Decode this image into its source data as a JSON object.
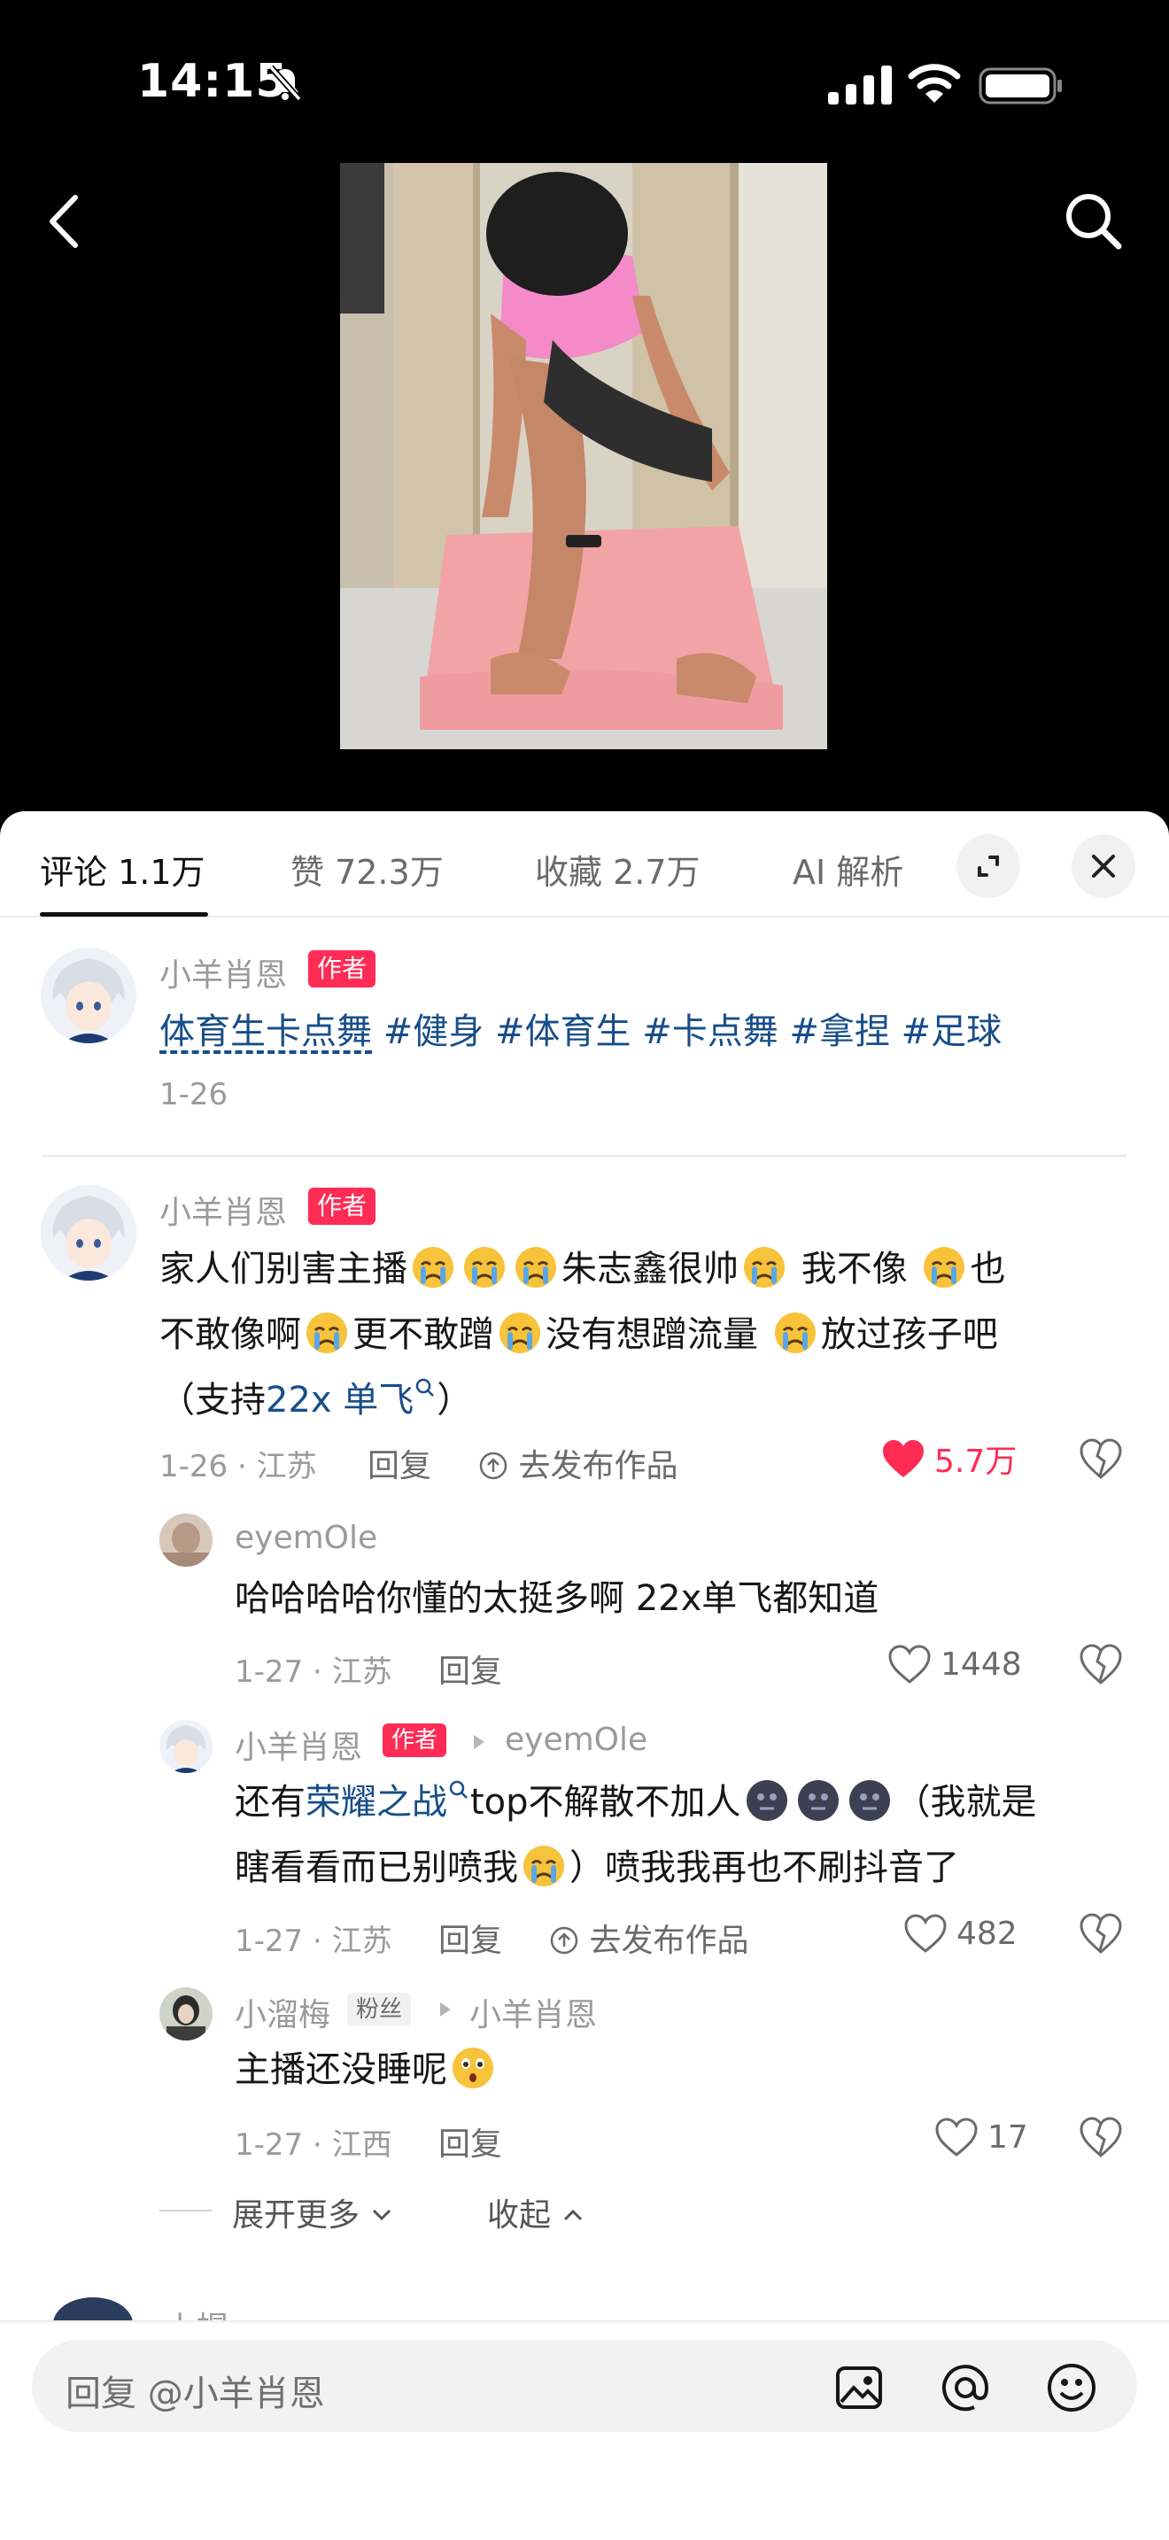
{
  "status": {
    "time": "14:15"
  },
  "tabs": [
    {
      "label": "评论 1.1万"
    },
    {
      "label": "赞 72.3万"
    },
    {
      "label": "收藏 2.7万"
    },
    {
      "label": "AI 解析"
    }
  ],
  "author_tag": "作者",
  "fan_tag": "粉丝",
  "reply_label": "回复",
  "publish_label": "去发布作品",
  "post": {
    "username": "小羊肖恩",
    "topic": "体育生卡点舞",
    "hashtags": [
      "#健身",
      "#体育生",
      "#卡点舞",
      "#拿捏",
      "#足球"
    ],
    "date": "1-26"
  },
  "comments": [
    {
      "username": "小羊肖恩",
      "line1_a": "家人们别害主播",
      "line1_b": "朱志鑫很帅",
      "line1_c": " 我不像 ",
      "line1_d": "也",
      "line2_a": "不敢像啊",
      "line2_b": "更不敢蹭",
      "line2_c": "没有想蹭流量 ",
      "line2_d": "放过孩子吧",
      "line3_a": "（支持",
      "line3_link": "22x 单飞",
      "line3_b": "）",
      "meta": "1-26 · 江苏",
      "likes": "5.7万"
    },
    {
      "username": "eyemOle",
      "text": "哈哈哈哈你懂的太挺多啊 22x单飞都知道",
      "meta": "1-27 · 江苏",
      "likes": "1448"
    },
    {
      "username": "小羊肖恩",
      "reply_to": "eyemOle",
      "line1_a": "还有",
      "line1_link": "荣耀之战",
      "line1_b": "top不解散不加人",
      "line1_c": "（我就是",
      "line2_a": "瞎看看而已别喷我",
      "line2_b": "）喷我我再也不刷抖音了",
      "meta": "1-27 · 江苏",
      "likes": "482"
    },
    {
      "username": "小溜梅",
      "reply_to": "小羊肖恩",
      "text": "主播还没睡呢",
      "meta": "1-27 · 江西",
      "likes": "17"
    }
  ],
  "expand_more": "展开更多",
  "collapse": "收起",
  "next_peek_name": "小帽",
  "input": {
    "placeholder": "回复 @小羊肖恩"
  },
  "colors": {
    "accent": "#fe2c55",
    "link": "#174e8a"
  }
}
